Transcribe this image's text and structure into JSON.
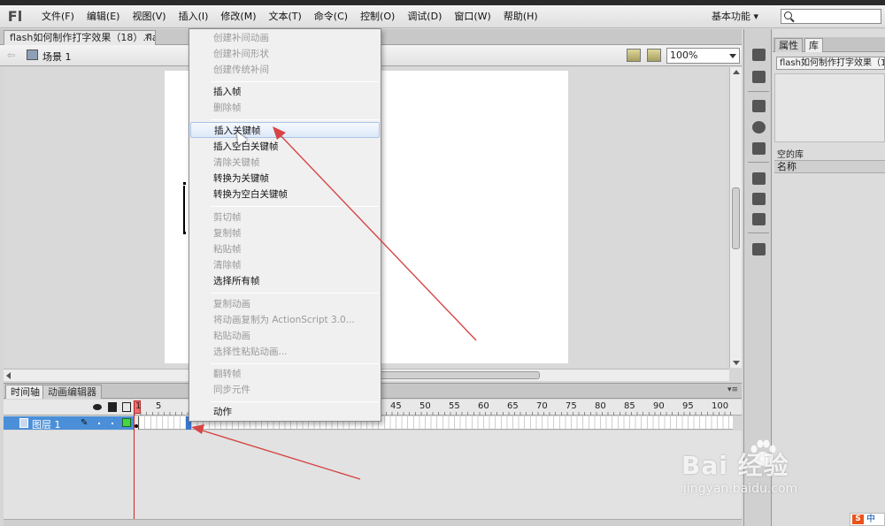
{
  "app": {
    "logo": "Fl"
  },
  "menubar": {
    "items": [
      "文件(F)",
      "编辑(E)",
      "视图(V)",
      "插入(I)",
      "修改(M)",
      "文本(T)",
      "命令(C)",
      "控制(O)",
      "调试(D)",
      "窗口(W)",
      "帮助(H)"
    ],
    "workspace": "基本功能"
  },
  "document": {
    "tab_title": "flash如何制作打字效果（18）.fla*"
  },
  "scene": {
    "label": "场景 1",
    "zoom": "100%"
  },
  "timeline": {
    "tabs": [
      "时间轴",
      "动画编辑器"
    ],
    "ruler": [
      "1",
      "5",
      "45",
      "50",
      "55",
      "60",
      "65",
      "70",
      "75",
      "80",
      "85",
      "90",
      "95",
      "100"
    ],
    "layer_name": "图层 1"
  },
  "context_menu": {
    "items": [
      {
        "label": "创建补间动画",
        "state": "disabled"
      },
      {
        "label": "创建补间形状",
        "state": "disabled"
      },
      {
        "label": "创建传统补间",
        "state": "disabled"
      },
      {
        "label": "插入帧",
        "state": "enabled"
      },
      {
        "label": "删除帧",
        "state": "disabled"
      },
      {
        "label": "插入关键帧",
        "state": "highlighted"
      },
      {
        "label": "插入空白关键帧",
        "state": "enabled"
      },
      {
        "label": "清除关键帧",
        "state": "disabled"
      },
      {
        "label": "转换为关键帧",
        "state": "enabled"
      },
      {
        "label": "转换为空白关键帧",
        "state": "enabled"
      },
      {
        "label": "剪切帧",
        "state": "disabled"
      },
      {
        "label": "复制帧",
        "state": "disabled"
      },
      {
        "label": "粘贴帧",
        "state": "disabled"
      },
      {
        "label": "清除帧",
        "state": "disabled"
      },
      {
        "label": "选择所有帧",
        "state": "enabled"
      },
      {
        "label": "复制动画",
        "state": "disabled"
      },
      {
        "label": "将动画复制为 ActionScript 3.0...",
        "state": "disabled"
      },
      {
        "label": "粘贴动画",
        "state": "disabled"
      },
      {
        "label": "选择性粘贴动画...",
        "state": "disabled"
      },
      {
        "label": "翻转帧",
        "state": "disabled"
      },
      {
        "label": "同步元件",
        "state": "disabled"
      },
      {
        "label": "动作",
        "state": "enabled"
      }
    ]
  },
  "right_panel": {
    "tabs": [
      "属性",
      "库"
    ],
    "library_select": "flash如何制作打字效果（1",
    "empty_library": "空的库",
    "name_column": "名称"
  },
  "watermark": {
    "brand": "Bai  经验",
    "url": "jingyan.baidu.com"
  },
  "ime": {
    "label": "中"
  },
  "colors": {
    "accent": "#4a8fd8",
    "annotation": "#d64545",
    "highlight": "#dde9f8"
  }
}
